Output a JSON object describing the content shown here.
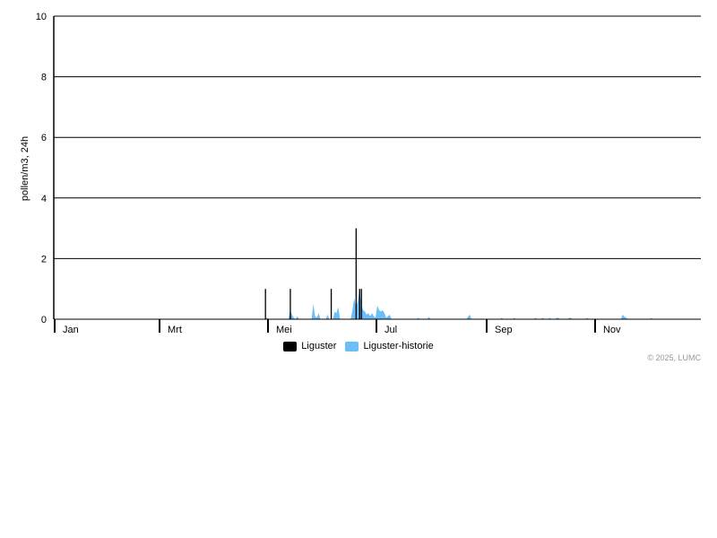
{
  "chart_data": {
    "type": "bar",
    "ylabel": "pollen/m3, 24h",
    "ylim": [
      0,
      10
    ],
    "yticks": [
      0,
      2,
      4,
      6,
      8,
      10
    ],
    "x_range_days": [
      1,
      365
    ],
    "month_ticks": [
      {
        "label": "Jan",
        "day": 1
      },
      {
        "label": "Mrt",
        "day": 60
      },
      {
        "label": "Mei",
        "day": 121
      },
      {
        "label": "Jul",
        "day": 182
      },
      {
        "label": "Sep",
        "day": 244
      },
      {
        "label": "Nov",
        "day": 305
      }
    ],
    "series": [
      {
        "name": "Liguster",
        "style": "bar",
        "color": "#000000",
        "points": [
          {
            "day": 120,
            "value": 1
          },
          {
            "day": 134,
            "value": 1
          },
          {
            "day": 157,
            "value": 1
          },
          {
            "day": 171,
            "value": 3
          },
          {
            "day": 173,
            "value": 1
          },
          {
            "day": 174,
            "value": 1
          }
        ]
      },
      {
        "name": "Liguster-historie",
        "style": "area",
        "color": "#6cbef7",
        "points": [
          {
            "day": 120,
            "value": 0
          },
          {
            "day": 121,
            "value": 0.05
          },
          {
            "day": 122,
            "value": 0
          },
          {
            "day": 133,
            "value": 0
          },
          {
            "day": 134,
            "value": 0.3
          },
          {
            "day": 135,
            "value": 0.15
          },
          {
            "day": 136,
            "value": 0.05
          },
          {
            "day": 137,
            "value": 0
          },
          {
            "day": 138,
            "value": 0.1
          },
          {
            "day": 139,
            "value": 0
          },
          {
            "day": 146,
            "value": 0
          },
          {
            "day": 147,
            "value": 0.5
          },
          {
            "day": 148,
            "value": 0.1
          },
          {
            "day": 149,
            "value": 0.05
          },
          {
            "day": 150,
            "value": 0.2
          },
          {
            "day": 151,
            "value": 0
          },
          {
            "day": 154,
            "value": 0
          },
          {
            "day": 155,
            "value": 0.15
          },
          {
            "day": 156,
            "value": 0
          },
          {
            "day": 158,
            "value": 0
          },
          {
            "day": 159,
            "value": 0.25
          },
          {
            "day": 160,
            "value": 0.2
          },
          {
            "day": 161,
            "value": 0.4
          },
          {
            "day": 162,
            "value": 0
          },
          {
            "day": 168,
            "value": 0
          },
          {
            "day": 169,
            "value": 0.3
          },
          {
            "day": 170,
            "value": 0.7
          },
          {
            "day": 171,
            "value": 0.4
          },
          {
            "day": 172,
            "value": 0.6
          },
          {
            "day": 173,
            "value": 0.95
          },
          {
            "day": 174,
            "value": 0.5
          },
          {
            "day": 175,
            "value": 0.3
          },
          {
            "day": 176,
            "value": 0.25
          },
          {
            "day": 177,
            "value": 0.15
          },
          {
            "day": 178,
            "value": 0.2
          },
          {
            "day": 179,
            "value": 0.1
          },
          {
            "day": 180,
            "value": 0.2
          },
          {
            "day": 181,
            "value": 0.1
          },
          {
            "day": 182,
            "value": 0.05
          },
          {
            "day": 183,
            "value": 0.45
          },
          {
            "day": 184,
            "value": 0.3
          },
          {
            "day": 185,
            "value": 0.25
          },
          {
            "day": 186,
            "value": 0.3
          },
          {
            "day": 187,
            "value": 0.2
          },
          {
            "day": 188,
            "value": 0.05
          },
          {
            "day": 189,
            "value": 0.1
          },
          {
            "day": 190,
            "value": 0.15
          },
          {
            "day": 191,
            "value": 0
          },
          {
            "day": 205,
            "value": 0
          },
          {
            "day": 206,
            "value": 0.05
          },
          {
            "day": 207,
            "value": 0
          },
          {
            "day": 211,
            "value": 0
          },
          {
            "day": 212,
            "value": 0.08
          },
          {
            "day": 213,
            "value": 0
          },
          {
            "day": 233,
            "value": 0
          },
          {
            "day": 234,
            "value": 0.08
          },
          {
            "day": 235,
            "value": 0.15
          },
          {
            "day": 236,
            "value": 0
          },
          {
            "day": 252,
            "value": 0
          },
          {
            "day": 253,
            "value": 0.05
          },
          {
            "day": 254,
            "value": 0
          },
          {
            "day": 259,
            "value": 0
          },
          {
            "day": 260,
            "value": 0.05
          },
          {
            "day": 261,
            "value": 0
          },
          {
            "day": 271,
            "value": 0
          },
          {
            "day": 272,
            "value": 0.05
          },
          {
            "day": 273,
            "value": 0
          },
          {
            "day": 275,
            "value": 0
          },
          {
            "day": 276,
            "value": 0.05
          },
          {
            "day": 277,
            "value": 0
          },
          {
            "day": 279,
            "value": 0
          },
          {
            "day": 280,
            "value": 0.05
          },
          {
            "day": 281,
            "value": 0
          },
          {
            "day": 283,
            "value": 0
          },
          {
            "day": 284,
            "value": 0.05
          },
          {
            "day": 285,
            "value": 0.04
          },
          {
            "day": 286,
            "value": 0
          },
          {
            "day": 290,
            "value": 0
          },
          {
            "day": 291,
            "value": 0.05
          },
          {
            "day": 292,
            "value": 0.04
          },
          {
            "day": 293,
            "value": 0
          },
          {
            "day": 300,
            "value": 0
          },
          {
            "day": 301,
            "value": 0.05
          },
          {
            "day": 302,
            "value": 0
          },
          {
            "day": 320,
            "value": 0
          },
          {
            "day": 321,
            "value": 0.15
          },
          {
            "day": 322,
            "value": 0.08
          },
          {
            "day": 323,
            "value": 0.05
          },
          {
            "day": 324,
            "value": 0
          },
          {
            "day": 336,
            "value": 0
          },
          {
            "day": 337,
            "value": 0.05
          },
          {
            "day": 338,
            "value": 0
          }
        ]
      }
    ],
    "legend_position": "bottom-center",
    "grid": true
  },
  "credit": "© 2025, LUMC"
}
